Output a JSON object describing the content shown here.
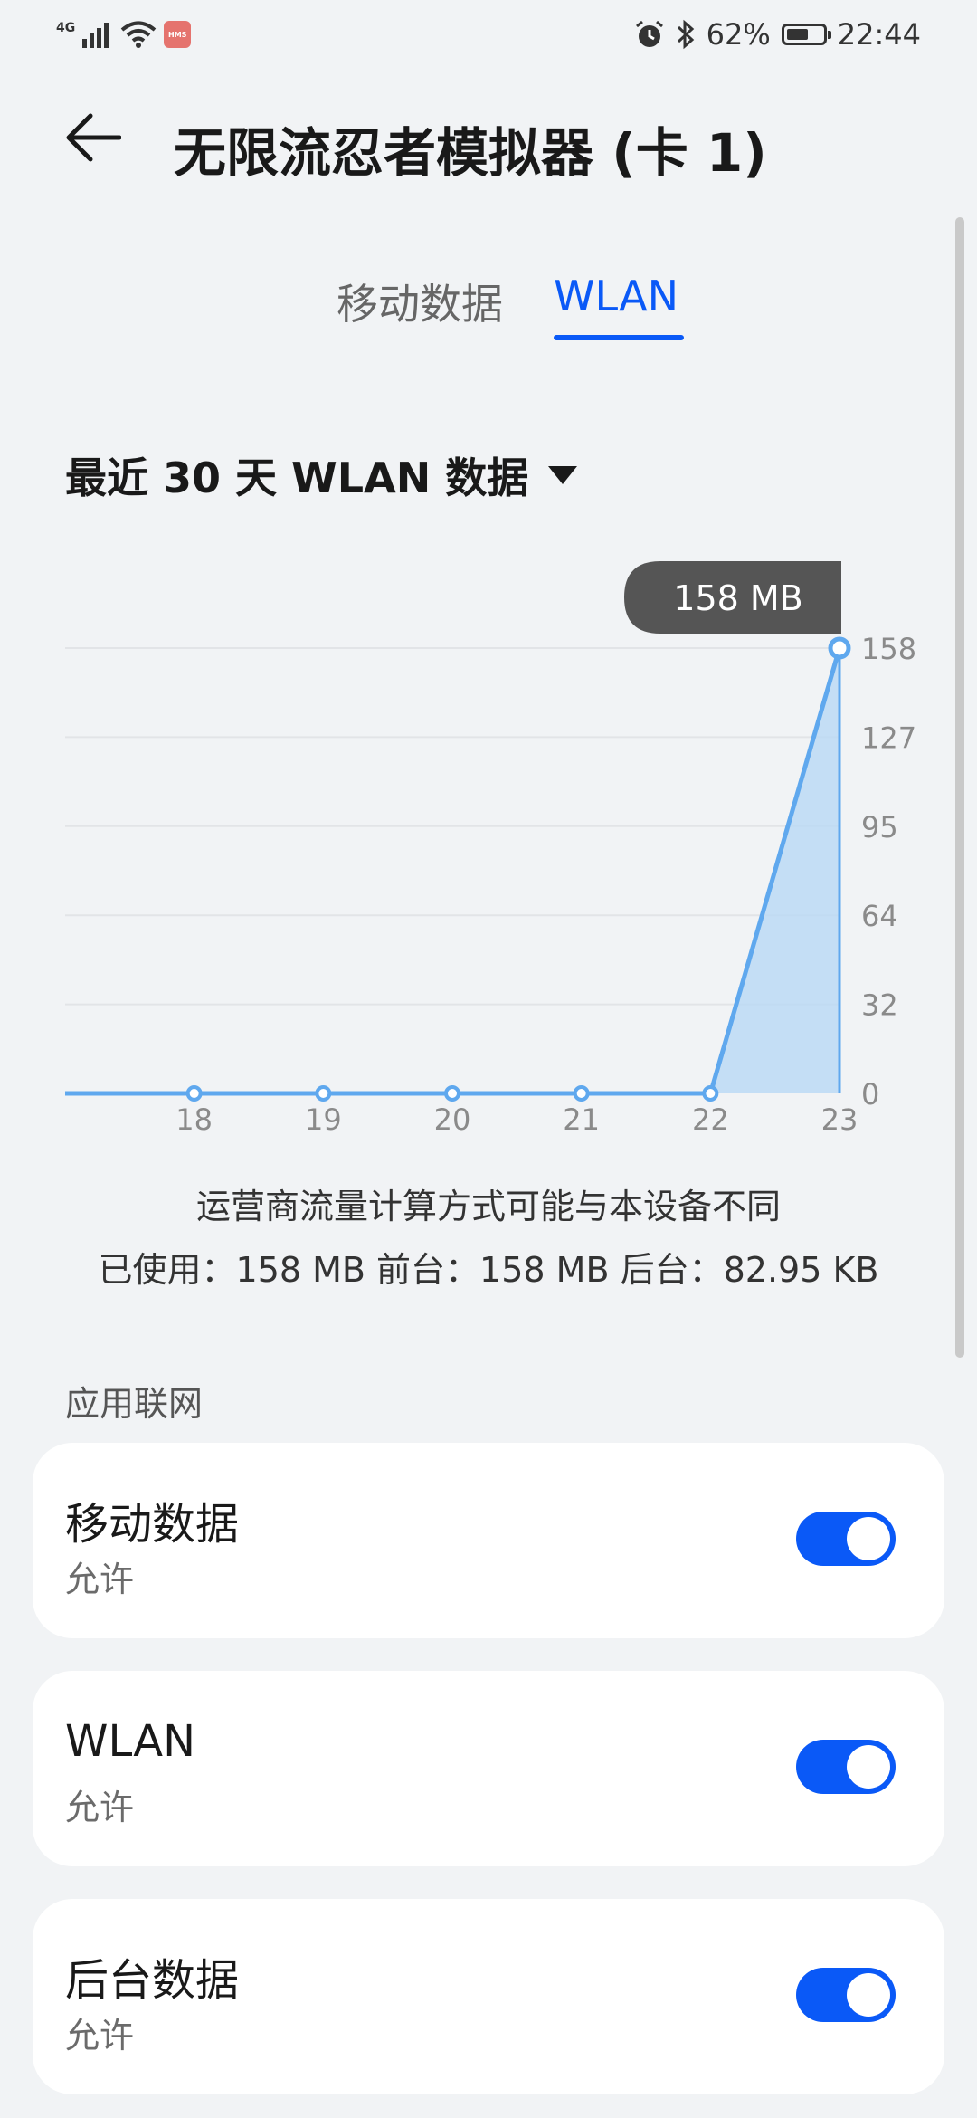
{
  "status_bar": {
    "network": "4G",
    "hms": "HMS",
    "battery": "62%",
    "battery_level": 0.62,
    "time": "22:44"
  },
  "header": {
    "title": "无限流忍者模拟器 (卡 1)"
  },
  "tabs": [
    {
      "label": "移动数据",
      "selected": false
    },
    {
      "label": "WLAN",
      "selected": true
    }
  ],
  "range_selector": {
    "label": "最近 30 天 WLAN 数据"
  },
  "chart_data": {
    "type": "line",
    "x": [
      17,
      18,
      19,
      20,
      21,
      22,
      23
    ],
    "x_tick_labels": [
      "18",
      "19",
      "20",
      "21",
      "22",
      "23"
    ],
    "values": [
      0,
      0,
      0,
      0,
      0,
      0,
      158
    ],
    "y_tick_labels": [
      "158",
      "127",
      "95",
      "64",
      "32",
      "0"
    ],
    "ylim": [
      0,
      158
    ],
    "tooltip": "158 MB",
    "grid": true,
    "colors": {
      "line": "#5fa8ee",
      "fill": "#b9d8f5",
      "tooltip_bg": "#555555"
    }
  },
  "summary": {
    "note": "运营商流量计算方式可能与本设备不同",
    "usage": "已使用：158 MB 前台：158 MB 后台：82.95 KB"
  },
  "section": {
    "label": "应用联网"
  },
  "cards": [
    {
      "title": "移动数据",
      "subtitle": "允许",
      "enabled": true
    },
    {
      "title": "WLAN",
      "subtitle": "允许",
      "enabled": true
    },
    {
      "title": "后台数据",
      "subtitle": "允许",
      "enabled": true
    }
  ],
  "accent_color": "#0a59f7"
}
